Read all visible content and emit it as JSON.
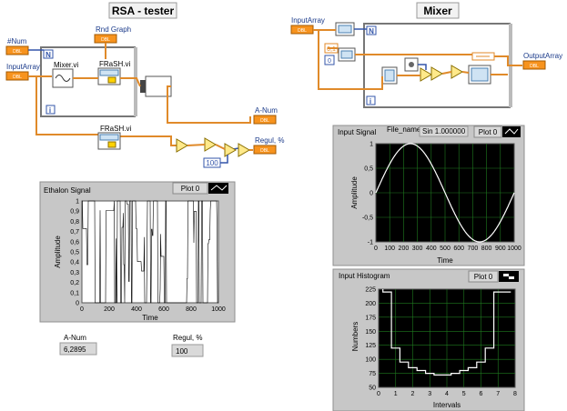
{
  "titles": {
    "rsa": "RSA - tester",
    "mixer": "Mixer"
  },
  "block_diagram_left": {
    "num_label": "#Num",
    "input_array_label": "InputArray",
    "rnd_graph_label": "Rnd Graph",
    "mixer_vi": "Mixer.vi",
    "frash_vi": "FRaSH.vi",
    "frash_vi_2": "FRaSH.vi",
    "a_num_label": "A-Num",
    "regul_label": "Regul, %",
    "const_100": "100",
    "for_loop_n": "N",
    "for_loop_i": "i",
    "dbl": "DBL"
  },
  "block_diagram_right": {
    "input_array_label": "InputArray",
    "output_array_label": "OutputArray",
    "const_01": "0,1",
    "const_0": "0",
    "for_loop_n": "N",
    "for_loop_i": "i",
    "dbl": "DBL"
  },
  "ethalon_graph": {
    "title": "Ethalon Signal",
    "plot_legend": "Plot 0",
    "ylabel": "Amplitude",
    "xlabel": "Time",
    "y_ticks": [
      "1",
      "0,9",
      "0,8",
      "0,7",
      "0,6",
      "0,5",
      "0,4",
      "0,3",
      "0,2",
      "0,1",
      "0"
    ],
    "x_ticks": [
      "0",
      "200",
      "400",
      "600",
      "800",
      "1000"
    ]
  },
  "input_signal_graph": {
    "title": "Input Signal",
    "file_name_label": "File_name",
    "file_name_value": "Sin 1.000000",
    "plot_legend": "Plot 0",
    "ylabel": "Amplitude",
    "xlabel": "Time",
    "y_ticks": [
      "1",
      "0,5",
      "0",
      "-0,5",
      "-1"
    ],
    "x_ticks": [
      "0",
      "100",
      "200",
      "300",
      "400",
      "500",
      "600",
      "700",
      "800",
      "900",
      "1000"
    ]
  },
  "input_histogram": {
    "title": "Input Histogram",
    "plot_legend": "Plot 0",
    "ylabel": "Numbers",
    "xlabel": "Intervals",
    "y_ticks": [
      "225",
      "200",
      "175",
      "150",
      "125",
      "100",
      "75",
      "50"
    ],
    "x_ticks": [
      "0",
      "1",
      "2",
      "3",
      "4",
      "5",
      "6",
      "7",
      "8"
    ]
  },
  "indicators": {
    "a_num_label": "A-Num",
    "a_num_value": "6,2895",
    "regul_label": "Regul, %",
    "regul_value": "100"
  },
  "chart_data": [
    {
      "type": "line",
      "title": "Ethalon Signal",
      "xlabel": "Time",
      "ylabel": "Amplitude",
      "xlim": [
        0,
        1000
      ],
      "ylim": [
        0,
        1
      ],
      "description_of_data": "random binary-like signal between 0 and 1",
      "colors": {
        "background": "#ffffff",
        "trace": "#000000"
      }
    },
    {
      "type": "line",
      "title": "Input Signal",
      "xlabel": "Time",
      "ylabel": "Amplitude",
      "xlim": [
        0,
        1000
      ],
      "ylim": [
        -1,
        1
      ],
      "x": [
        0,
        125,
        250,
        375,
        500,
        625,
        750,
        875,
        1000
      ],
      "y": [
        0,
        0.71,
        1,
        0.71,
        0,
        -0.71,
        -1,
        -0.71,
        0
      ],
      "colors": {
        "background": "#000000",
        "grid": "#1f7a1f",
        "trace": "#ffffff"
      }
    },
    {
      "type": "bar",
      "title": "Input Histogram",
      "xlabel": "Intervals",
      "ylabel": "Numbers",
      "xlim": [
        0,
        8
      ],
      "ylim": [
        50,
        225
      ],
      "x": [
        0.5,
        1.0,
        1.5,
        2.0,
        2.5,
        3.0,
        3.5,
        4.0,
        4.5,
        5.0,
        5.5,
        6.0,
        6.5,
        7.0,
        7.5
      ],
      "values": [
        220,
        120,
        95,
        85,
        80,
        75,
        72,
        72,
        75,
        80,
        85,
        95,
        120,
        220,
        220
      ],
      "colors": {
        "background": "#000000",
        "grid": "#1f7a1f",
        "bar": "#ffffff"
      }
    }
  ]
}
